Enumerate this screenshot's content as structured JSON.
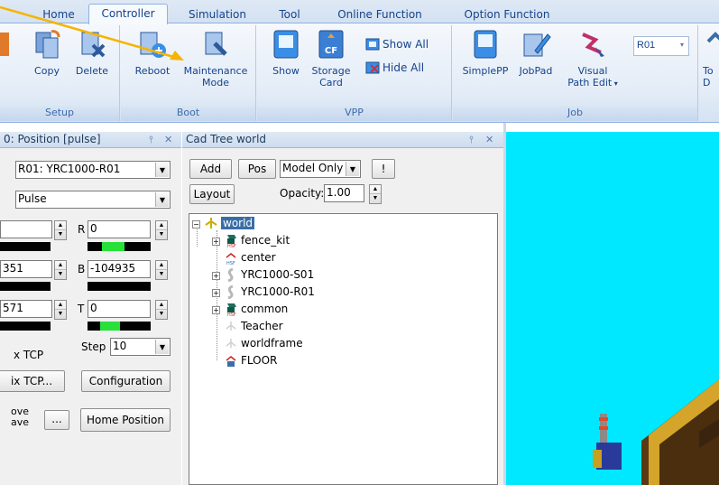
{
  "tabs": [
    {
      "label": "Home",
      "active": false
    },
    {
      "label": "Controller",
      "active": true
    },
    {
      "label": "Simulation",
      "active": false
    },
    {
      "label": "Tool",
      "active": false
    },
    {
      "label": "Online Function",
      "active": false
    },
    {
      "label": "Option Function",
      "active": false
    }
  ],
  "ribbon": {
    "setup": {
      "label": "Setup",
      "copy": "Copy",
      "delete": "Delete"
    },
    "boot": {
      "label": "Boot",
      "reboot": "Reboot",
      "maintenance_1": "Maintenance",
      "maintenance_2": "Mode"
    },
    "vpp": {
      "label": "VPP",
      "show": "Show",
      "storage_1": "Storage",
      "storage_2": "Card",
      "show_all": "Show All",
      "hide_all": "Hide All",
      "cf_text": "CF"
    },
    "job": {
      "label": "Job",
      "simplepp": "SimplePP",
      "jobpad": "JobPad",
      "visual_1": "Visual",
      "visual_2": "Path Edit",
      "robot_select": "R01"
    },
    "cut": {
      "line1": "To",
      "line2": "D"
    }
  },
  "position_panel": {
    "title": "0: Position [pulse]",
    "pin": "⫯",
    "close": "✕",
    "robot_select": "R01: YRC1000-R01",
    "unit_select": "Pulse",
    "axis_r_label": "R",
    "axis_r_value": "0",
    "axis_b_label": "B",
    "axis_b_value": "-104935",
    "axis_t_label": "T",
    "axis_t_value": "0",
    "left_value_2": "351",
    "left_value_3": "571",
    "tcp_label": "x TCP",
    "step_label": "Step",
    "step_value": "10",
    "fix_tcp_button": "ix TCP...",
    "configuration_button": "Configuration",
    "move_line1": "ove",
    "move_line2": "ave",
    "ellipsis_button": "...",
    "home_position_button": "Home Position"
  },
  "cad_panel": {
    "title": "Cad Tree world",
    "pin": "⫯",
    "close": "✕",
    "add_button": "Add",
    "pos_button": "Pos",
    "model_select": "Model Only",
    "exclaim_button": "!",
    "layout_button": "Layout",
    "opacity_label": "Opacity:",
    "opacity_value": "1.00",
    "tree": [
      {
        "label": "world",
        "selected": true
      },
      {
        "label": "fence_kit",
        "selected": false
      },
      {
        "label": "center",
        "selected": false
      },
      {
        "label": "YRC1000-S01",
        "selected": false
      },
      {
        "label": "YRC1000-R01",
        "selected": false
      },
      {
        "label": "common",
        "selected": false
      },
      {
        "label": "Teacher",
        "selected": false
      },
      {
        "label": "worldframe",
        "selected": false
      },
      {
        "label": "FLOOR",
        "selected": false
      }
    ]
  },
  "bars": {
    "r_fill": 0.35,
    "t_fill": 0.32
  },
  "colors": {
    "viewport_bg": "#00e8ff",
    "annotation_arrow": "#f5b400",
    "tree_selection": "#3a6ea5"
  }
}
